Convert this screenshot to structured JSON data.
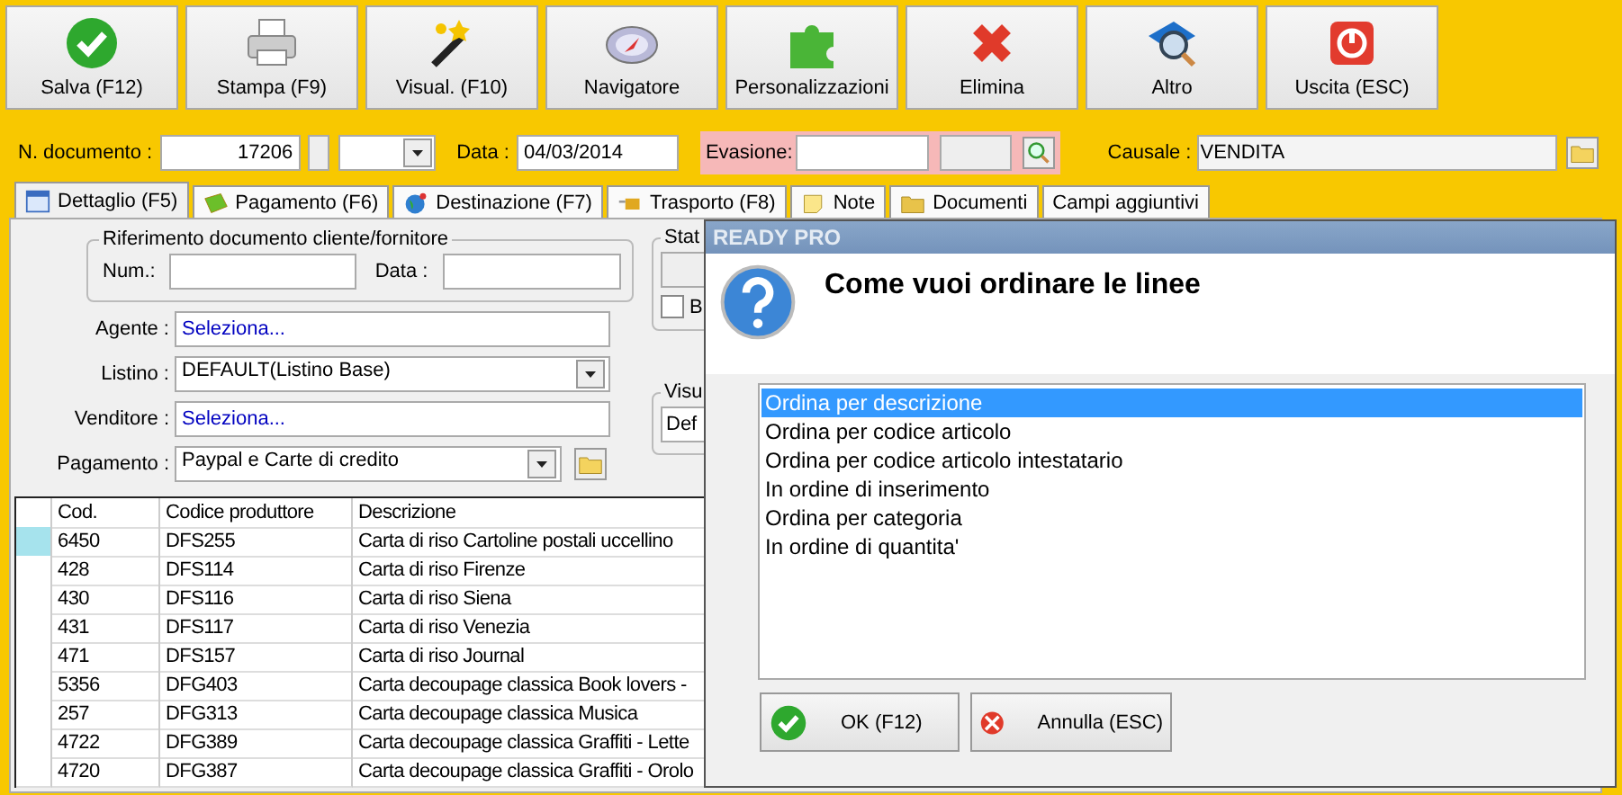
{
  "toolbar": [
    {
      "label": "Salva (F12)"
    },
    {
      "label": "Stampa (F9)"
    },
    {
      "label": "Visual. (F10)"
    },
    {
      "label": "Navigatore"
    },
    {
      "label": "Personalizzazioni"
    },
    {
      "label": "Elimina"
    },
    {
      "label": "Altro"
    },
    {
      "label": "Uscita (ESC)"
    }
  ],
  "document": {
    "number_label": "N. documento :",
    "number": "17206",
    "date_label": "Data :",
    "date": "04/03/2014",
    "evasione_label": "Evasione:",
    "causale_label": "Causale :",
    "causale": "VENDITA"
  },
  "tabs": [
    {
      "label": "Dettaglio (F5)",
      "selected": true
    },
    {
      "label": "Pagamento (F6)",
      "selected": false
    },
    {
      "label": "Destinazione (F7)",
      "selected": false
    },
    {
      "label": "Trasporto (F8)",
      "selected": false
    },
    {
      "label": "Note",
      "selected": false
    },
    {
      "label": "Documenti",
      "selected": false
    },
    {
      "label": "Campi aggiuntivi",
      "selected": false
    }
  ],
  "reference_group": {
    "title": "Riferimento documento cliente/fornitore",
    "num_label": "Num.:",
    "date_label": "Data :"
  },
  "fields": [
    {
      "kind": "link",
      "label": "Agente :",
      "value": "Seleziona..."
    },
    {
      "kind": "select",
      "label": "Listino :",
      "value": "DEFAULT(Listino Base)"
    },
    {
      "kind": "link",
      "label": "Venditore :",
      "value": "Seleziona..."
    },
    {
      "kind": "select-folder",
      "label": "Pagamento :",
      "value": "Paypal e Carte di credito"
    }
  ],
  "status_group": {
    "title": "Stat",
    "checkbox_label": "B",
    "checked": false
  },
  "view_group": {
    "title": "Visu",
    "value": "Def"
  },
  "table": {
    "columns": [
      "Cod.",
      "Codice produttore",
      "Descrizione"
    ],
    "rows": [
      {
        "selected": true,
        "cells": [
          "6450",
          "DFS255",
          "Carta di riso Cartoline postali uccellino"
        ]
      },
      {
        "selected": false,
        "cells": [
          "428",
          "DFS114",
          "Carta di riso Firenze"
        ]
      },
      {
        "selected": false,
        "cells": [
          "430",
          "DFS116",
          "Carta di riso Siena"
        ]
      },
      {
        "selected": false,
        "cells": [
          "431",
          "DFS117",
          "Carta di riso Venezia"
        ]
      },
      {
        "selected": false,
        "cells": [
          "471",
          "DFS157",
          "Carta di riso Journal"
        ]
      },
      {
        "selected": false,
        "cells": [
          "5356",
          "DFG403",
          "Carta decoupage classica Book lovers -"
        ]
      },
      {
        "selected": false,
        "cells": [
          "257",
          "DFG313",
          "Carta decoupage classica Musica"
        ]
      },
      {
        "selected": false,
        "cells": [
          "4722",
          "DFG389",
          "Carta decoupage classica Graffiti - Lette"
        ]
      },
      {
        "selected": false,
        "cells": [
          "4720",
          "DFG387",
          "Carta decoupage classica Graffiti - Orolo"
        ]
      }
    ]
  },
  "dialog": {
    "title": "READY PRO",
    "message": "Come vuoi ordinare le linee",
    "options": [
      {
        "label": "Ordina per descrizione",
        "selected": true
      },
      {
        "label": "Ordina per codice articolo",
        "selected": false
      },
      {
        "label": "Ordina per codice articolo intestatario",
        "selected": false
      },
      {
        "label": "In ordine di inserimento",
        "selected": false
      },
      {
        "label": "Ordina per categoria",
        "selected": false
      },
      {
        "label": "In ordine di quantita'",
        "selected": false
      }
    ],
    "buttons": [
      {
        "kind": "ok",
        "label": "OK (F12)"
      },
      {
        "kind": "cancel",
        "label": "Annulla (ESC)"
      }
    ]
  }
}
